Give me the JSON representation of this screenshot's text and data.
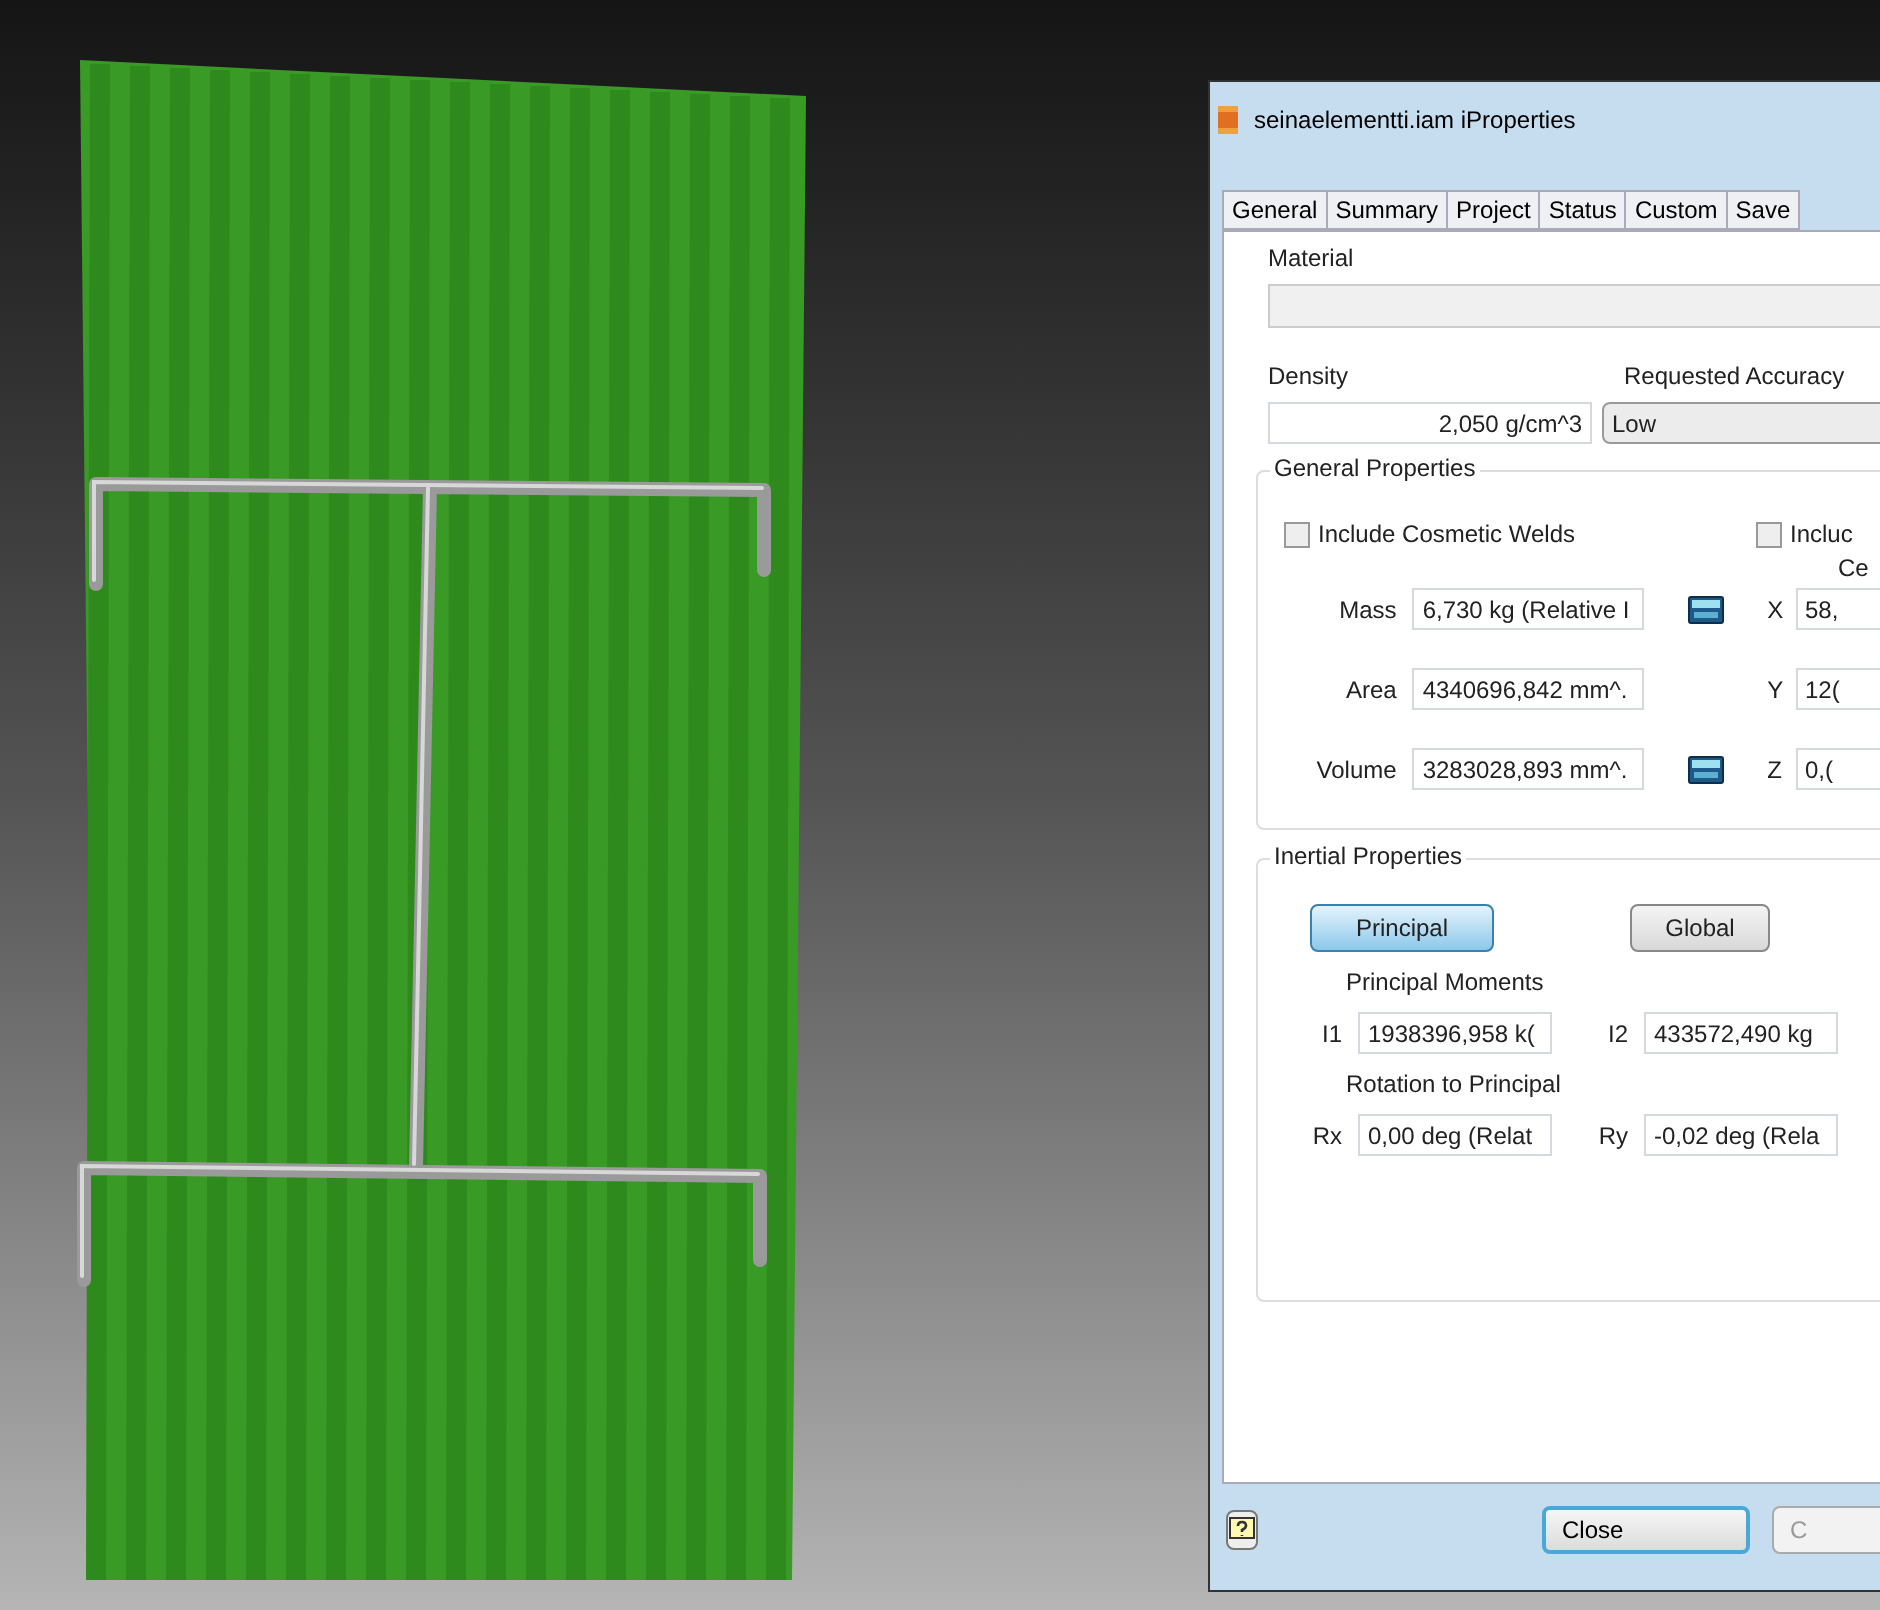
{
  "window": {
    "title": "seinaelementti.iam iProperties"
  },
  "tabs": [
    {
      "label": "General",
      "selected": false
    },
    {
      "label": "Summary",
      "selected": false
    },
    {
      "label": "Project",
      "selected": false
    },
    {
      "label": "Status",
      "selected": false
    },
    {
      "label": "Custom",
      "selected": false
    },
    {
      "label": "Save",
      "selected": false
    }
  ],
  "material": {
    "label": "Material"
  },
  "density": {
    "label": "Density",
    "value": "2,050 g/cm^3"
  },
  "accuracy": {
    "label": "Requested Accuracy",
    "value": "Low"
  },
  "general_properties": {
    "title": "General Properties",
    "checkboxes": [
      {
        "label": "Include Cosmetic Welds",
        "checked": false
      },
      {
        "label": "Incluc",
        "checked": false
      }
    ],
    "center_label": "Ce",
    "rows": [
      {
        "label": "Mass",
        "value": "6,730 kg (Relative I",
        "calculator": true,
        "axis": "X",
        "axis_value": "58,"
      },
      {
        "label": "Area",
        "value": "4340696,842 mm^.",
        "calculator": false,
        "axis": "Y",
        "axis_value": "12("
      },
      {
        "label": "Volume",
        "value": "3283028,893 mm^.",
        "calculator": true,
        "axis": "Z",
        "axis_value": "0,("
      }
    ]
  },
  "inertial_properties": {
    "title": "Inertial Properties",
    "modes": [
      {
        "label": "Principal",
        "selected": true
      },
      {
        "label": "Global",
        "selected": false
      }
    ],
    "moments_label": "Principal Moments",
    "moments": [
      {
        "label": "I1",
        "value": "1938396,958 k("
      },
      {
        "label": "I2",
        "value": "433572,490 kg"
      }
    ],
    "rotation_label": "Rotation to Principal",
    "rotations": [
      {
        "label": "Rx",
        "value": "0,00 deg (Relat"
      },
      {
        "label": "Ry",
        "value": "-0,02 deg (Rela"
      }
    ]
  },
  "buttons": [
    {
      "label": "Close",
      "default": true,
      "disabled": false
    },
    {
      "label": "C",
      "default": false,
      "disabled": true
    }
  ]
}
